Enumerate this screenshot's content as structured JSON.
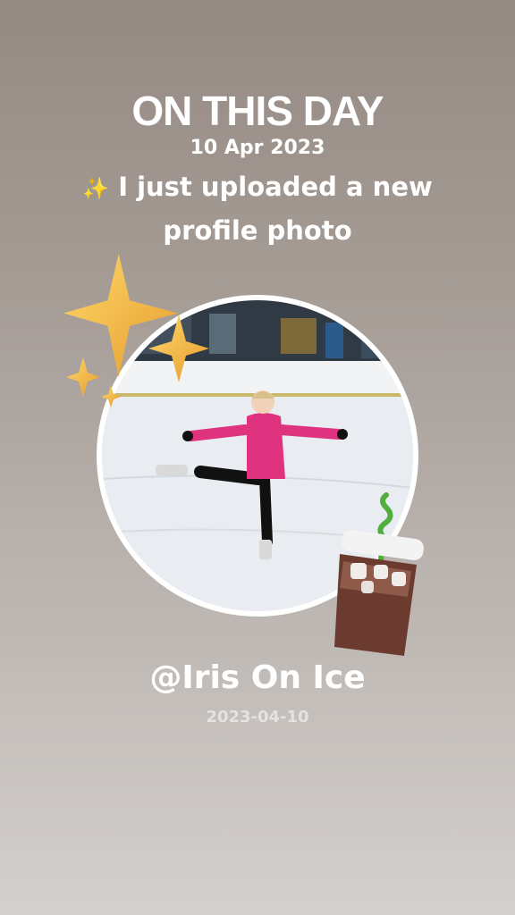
{
  "header": {
    "title": "ON THIS DAY",
    "date": "10 Apr 2023",
    "caption_emoji": "✨",
    "caption": "I just uploaded a new profile photo"
  },
  "profile": {
    "handle": "@Iris On Ice",
    "date": "2023-04-10"
  },
  "stickers": {
    "left": "sparkles-stars",
    "right": "iced-coffee"
  },
  "colors": {
    "background_top": "#958a83",
    "background_bottom": "#d4d0cd",
    "text": "#ffffff",
    "star": "#f2b84b",
    "jacket": "#e0337f"
  }
}
